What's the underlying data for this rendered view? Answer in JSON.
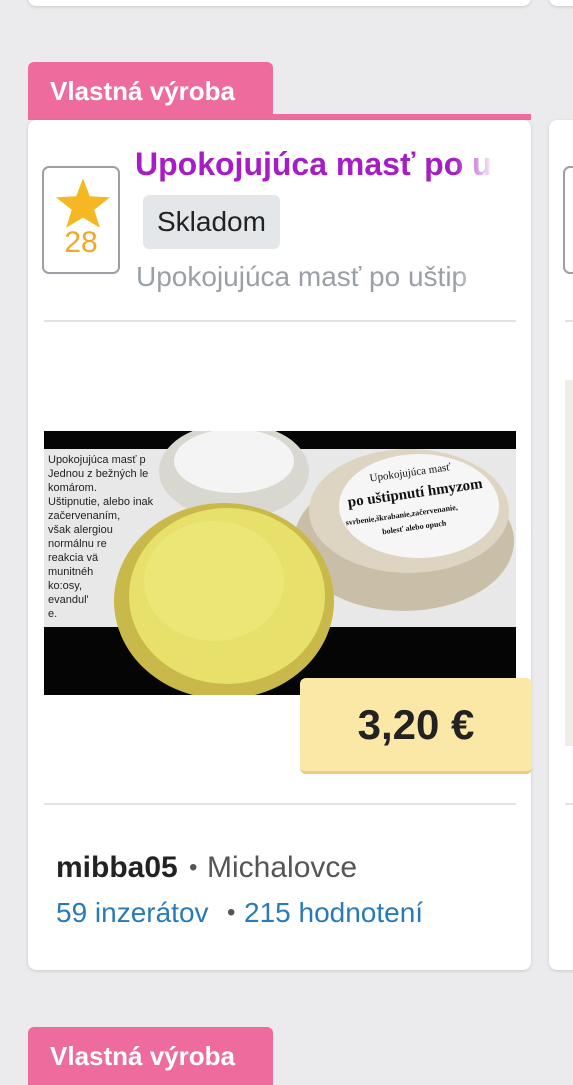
{
  "card": {
    "tag_label": "Vlastná výroba",
    "rating": "28",
    "title": "Upokojujúca masť po uš",
    "stock_badge": "Skladom",
    "description": "Upokojujúca masť po uštip",
    "photo": {
      "label_lines": [
        "Upokojujúca masť",
        "po uštipnutí hmyzom",
        "svrbenie,škrabanie,začervenanie,",
        "bolesť alebo opuch"
      ],
      "left_text": [
        "Upokojujúca masť p",
        "Jednou z bežných le",
        "komárom.",
        "Uštipnutie, alebo inak",
        "začervenaním,",
        "však alergiou",
        "normálnu re",
        "reakcia vä",
        "munitnéh",
        "ko:osy,",
        "evandul'",
        "e."
      ]
    },
    "price": "3,20 €",
    "seller": {
      "name": "mibba05",
      "separator": "•",
      "city": "Michalovce",
      "listings": "59 inzerátov",
      "reviews": "215 hodnotení"
    }
  },
  "next_card": {
    "tag_label": "Vlastná výroba"
  },
  "colors": {
    "tag": "#ee6b9e",
    "title": "#a61dc6",
    "star": "#f5b823",
    "price_bg": "#fbe8a6",
    "link": "#2a7ab8"
  }
}
